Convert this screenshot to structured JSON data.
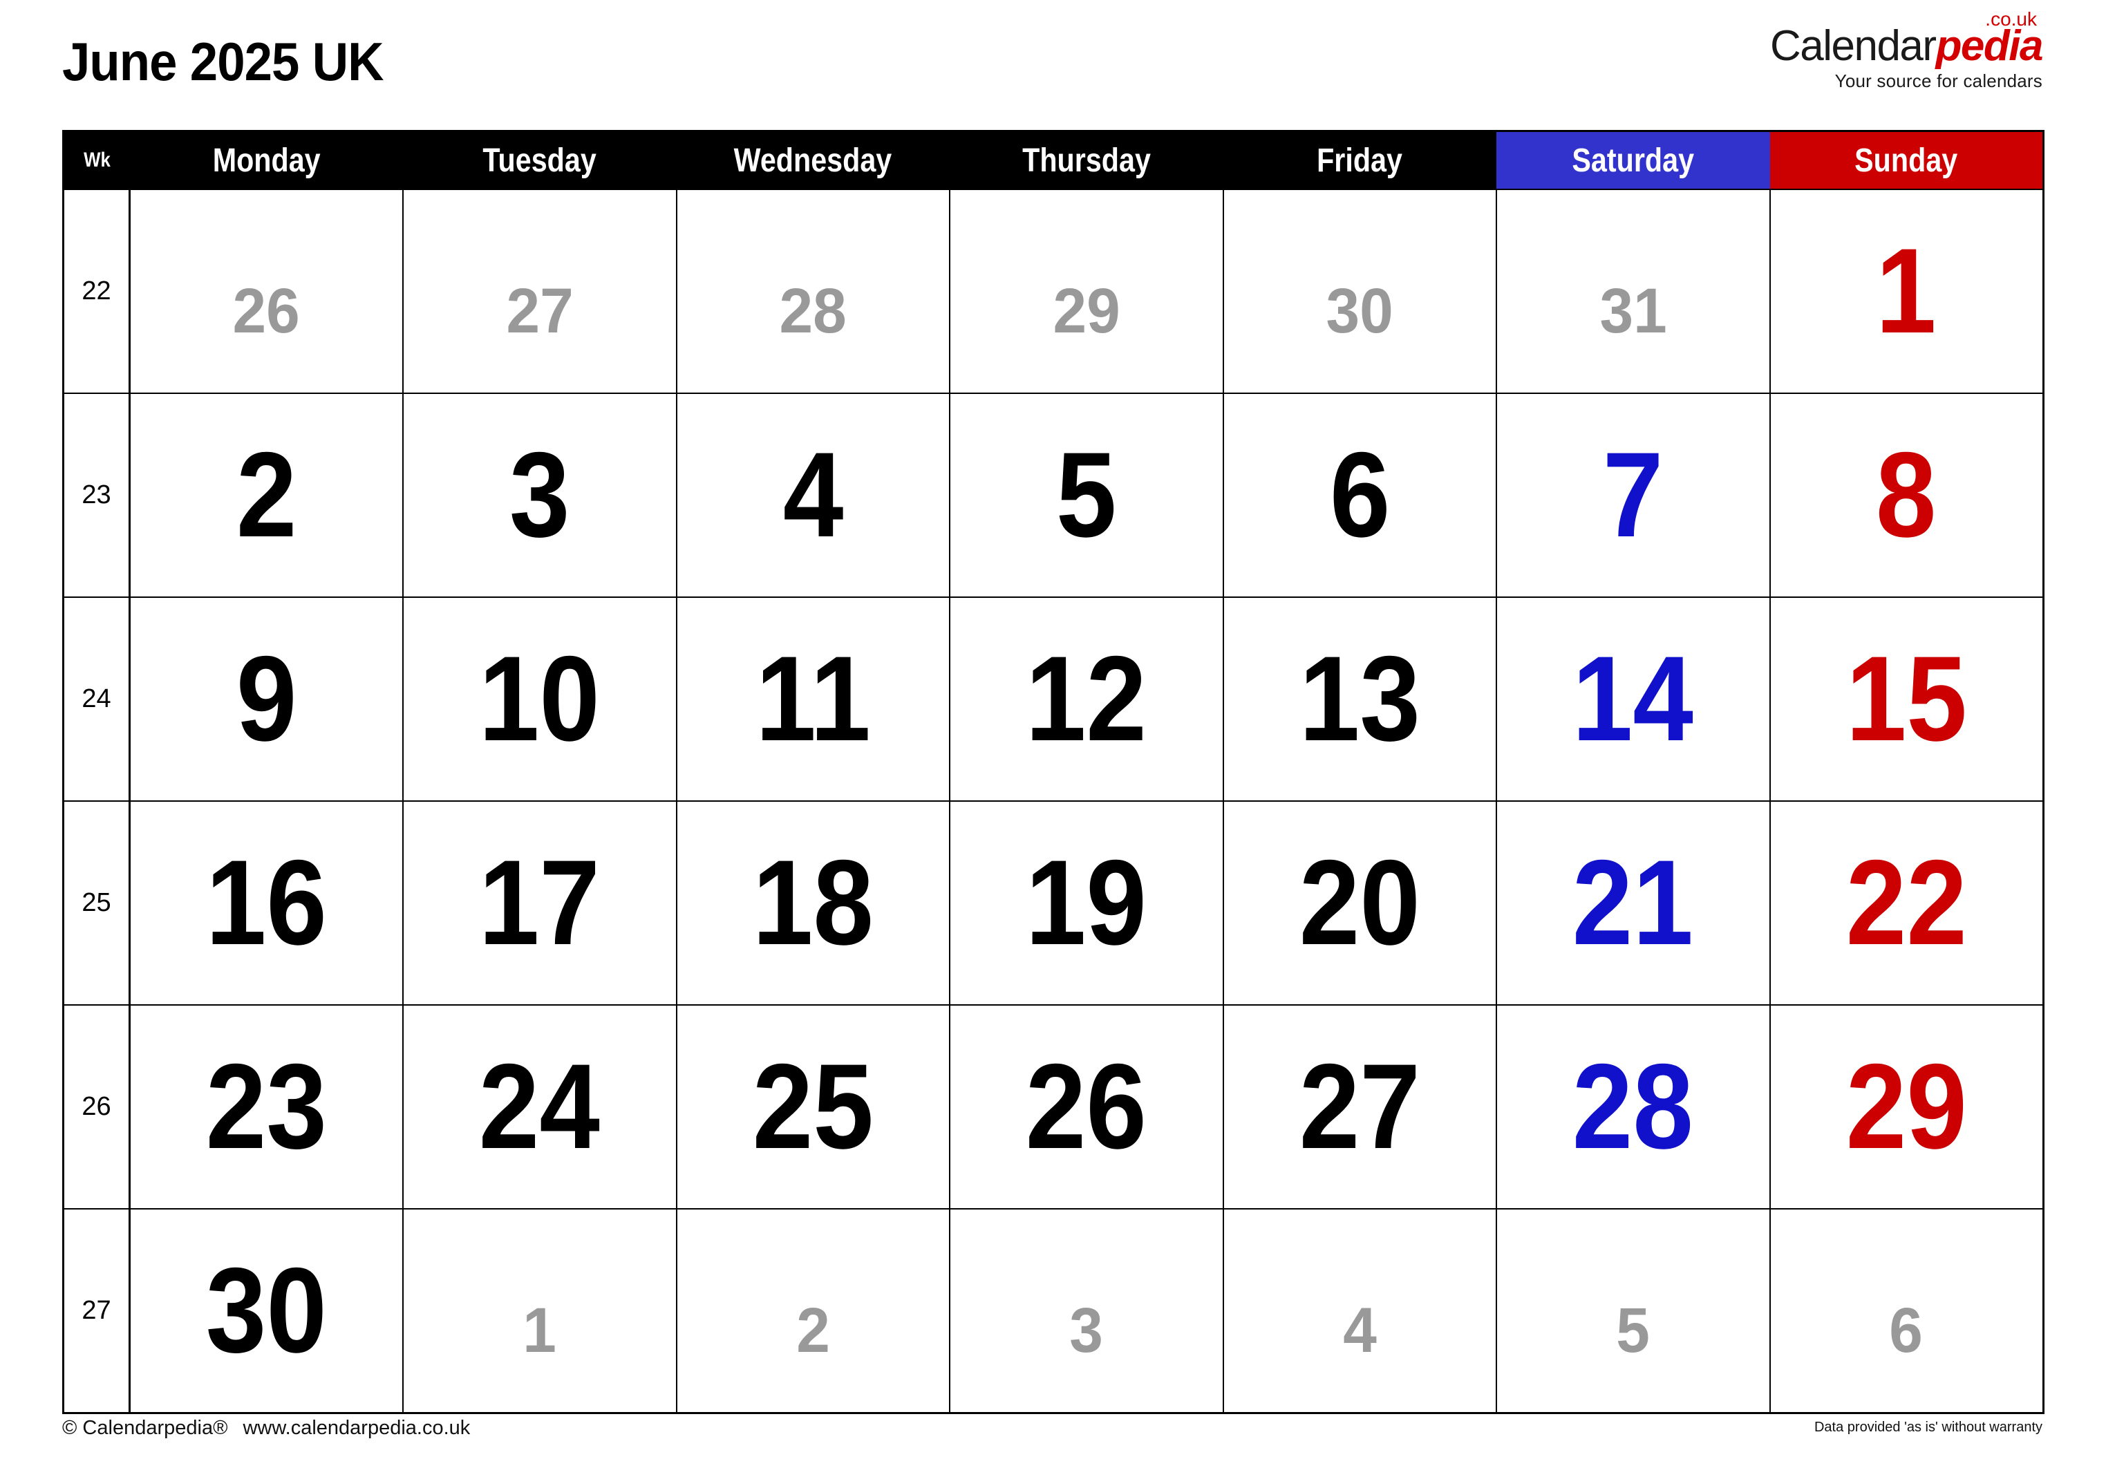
{
  "page": {
    "title": "June 2025 UK",
    "locale": "UK"
  },
  "brand": {
    "name_black": "Calendar",
    "name_red": "pedia",
    "tld": ".co.uk",
    "tagline": "Your source for calendars"
  },
  "table": {
    "week_header": "Wk",
    "day_headers": [
      "Monday",
      "Tuesday",
      "Wednesday",
      "Thursday",
      "Friday",
      "Saturday",
      "Sunday"
    ],
    "colors": {
      "header_bg": "#000000",
      "header_text": "#ffffff",
      "saturday_bg": "#3232cc",
      "sunday_bg": "#cc0000",
      "saturday_text": "#1111cc",
      "sunday_text": "#cc0000",
      "other_month_text": "#999999",
      "grid_line": "#000000"
    },
    "rows": [
      {
        "week": "22",
        "days": [
          {
            "n": "26",
            "kind": "other"
          },
          {
            "n": "27",
            "kind": "other"
          },
          {
            "n": "28",
            "kind": "other"
          },
          {
            "n": "29",
            "kind": "other"
          },
          {
            "n": "30",
            "kind": "other"
          },
          {
            "n": "31",
            "kind": "other"
          },
          {
            "n": "1",
            "kind": "sun"
          }
        ]
      },
      {
        "week": "23",
        "days": [
          {
            "n": "2",
            "kind": "wd"
          },
          {
            "n": "3",
            "kind": "wd"
          },
          {
            "n": "4",
            "kind": "wd"
          },
          {
            "n": "5",
            "kind": "wd"
          },
          {
            "n": "6",
            "kind": "wd"
          },
          {
            "n": "7",
            "kind": "sat"
          },
          {
            "n": "8",
            "kind": "sun"
          }
        ]
      },
      {
        "week": "24",
        "days": [
          {
            "n": "9",
            "kind": "wd"
          },
          {
            "n": "10",
            "kind": "wd"
          },
          {
            "n": "11",
            "kind": "wd"
          },
          {
            "n": "12",
            "kind": "wd"
          },
          {
            "n": "13",
            "kind": "wd"
          },
          {
            "n": "14",
            "kind": "sat"
          },
          {
            "n": "15",
            "kind": "sun"
          }
        ]
      },
      {
        "week": "25",
        "days": [
          {
            "n": "16",
            "kind": "wd"
          },
          {
            "n": "17",
            "kind": "wd"
          },
          {
            "n": "18",
            "kind": "wd"
          },
          {
            "n": "19",
            "kind": "wd"
          },
          {
            "n": "20",
            "kind": "wd"
          },
          {
            "n": "21",
            "kind": "sat"
          },
          {
            "n": "22",
            "kind": "sun"
          }
        ]
      },
      {
        "week": "26",
        "days": [
          {
            "n": "23",
            "kind": "wd"
          },
          {
            "n": "24",
            "kind": "wd"
          },
          {
            "n": "25",
            "kind": "wd"
          },
          {
            "n": "26",
            "kind": "wd"
          },
          {
            "n": "27",
            "kind": "wd"
          },
          {
            "n": "28",
            "kind": "sat"
          },
          {
            "n": "29",
            "kind": "sun"
          }
        ]
      },
      {
        "week": "27",
        "days": [
          {
            "n": "30",
            "kind": "wd"
          },
          {
            "n": "1",
            "kind": "other"
          },
          {
            "n": "2",
            "kind": "other"
          },
          {
            "n": "3",
            "kind": "other"
          },
          {
            "n": "4",
            "kind": "other"
          },
          {
            "n": "5",
            "kind": "other"
          },
          {
            "n": "6",
            "kind": "other"
          }
        ]
      }
    ]
  },
  "footer": {
    "copyright": "© Calendarpedia®",
    "website": "www.calendarpedia.co.uk",
    "disclaimer": "Data provided 'as is' without warranty"
  }
}
